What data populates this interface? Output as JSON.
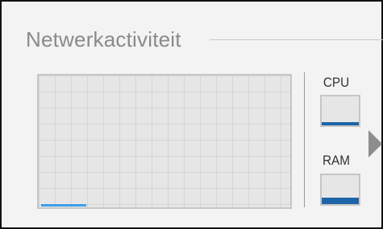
{
  "panel": {
    "title": "Netwerkactiviteit"
  },
  "network": {
    "activity_fraction": 0.18,
    "line_color": "#3aa0e8"
  },
  "cpu": {
    "label": "CPU",
    "level_fraction": 0.1,
    "fill_color": "#1e63a6"
  },
  "ram": {
    "label": "RAM",
    "level_fraction": 0.22,
    "fill_color": "#1e63a6"
  },
  "expand_icon": "chevron-right-icon"
}
